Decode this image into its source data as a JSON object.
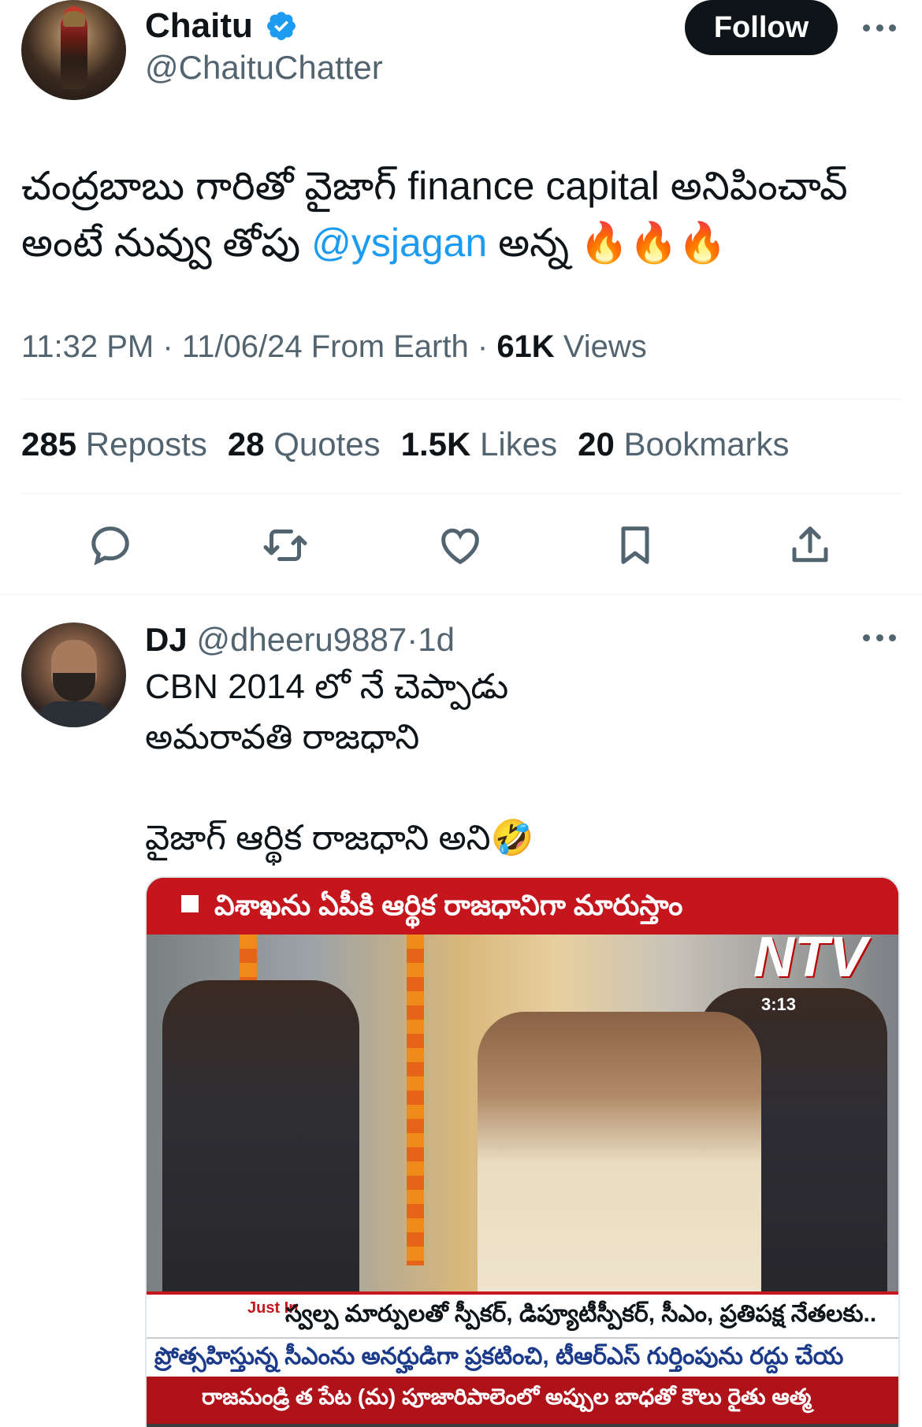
{
  "tweet": {
    "author_name": "Chaitu",
    "author_handle": "@ChaituChatter",
    "follow_label": "Follow",
    "text_before": "చంద్రబాబు గారితో వైజాగ్ finance capital అనిపించావ్ అంటే నువ్వు తోపు ",
    "mention": "@ysjagan",
    "text_after": " అన్న 🔥🔥🔥",
    "time": "11:32 PM",
    "date": "11/06/24",
    "location": "From Earth",
    "views_count": "61K",
    "views_label": "Views",
    "separator": "·"
  },
  "stats": {
    "reposts_count": "285",
    "reposts_label": "Reposts",
    "quotes_count": "28",
    "quotes_label": "Quotes",
    "likes_count": "1.5K",
    "likes_label": "Likes",
    "bookmarks_count": "20",
    "bookmarks_label": "Bookmarks"
  },
  "actions": {
    "icons": [
      "reply-icon",
      "repost-icon",
      "like-icon",
      "bookmark-icon",
      "share-icon"
    ],
    "icon_color": "#536471"
  },
  "reply": {
    "author_name": "DJ",
    "author_handle": "@dheeru9887",
    "separator": "·",
    "age": "1d",
    "text": "CBN 2014 లో నే చెప్పాడు\nఅమరావతి రాజధాని\n\nవైజాగ్ ఆర్థిక రాజధాని అని🤣",
    "media": {
      "top_banner": "విశాఖను ఏపీకి ఆర్థిక రాజధానిగా మారుస్తాం",
      "channel_logo": "NTV",
      "clock": "3:13",
      "just_in": "Just In",
      "ticker_1": "స్వల్ప మార్పులతో స్పీకర్, డిప్యూటీస్పీకర్, సీఎం, ప్రతిపక్ష నేతలకు..",
      "ticker_2": "ప్రోత్సహిస్తున్న సీఎంను అనర్హుడిగా ప్రకటించి, టీఆర్ఎస్ గుర్తింపును రద్దు చేయ",
      "ticker_3": "రాజమండ్రి త పేట (మ) పూజారిపాలెంలో అప్పుల బాధతో కౌలు రైతు ఆత్మ"
    }
  },
  "colors": {
    "text_primary": "#0f1419",
    "text_secondary": "#536471",
    "link": "#1d9bf0",
    "verified": "#1d9bf0",
    "follow_bg": "#0f1419"
  }
}
